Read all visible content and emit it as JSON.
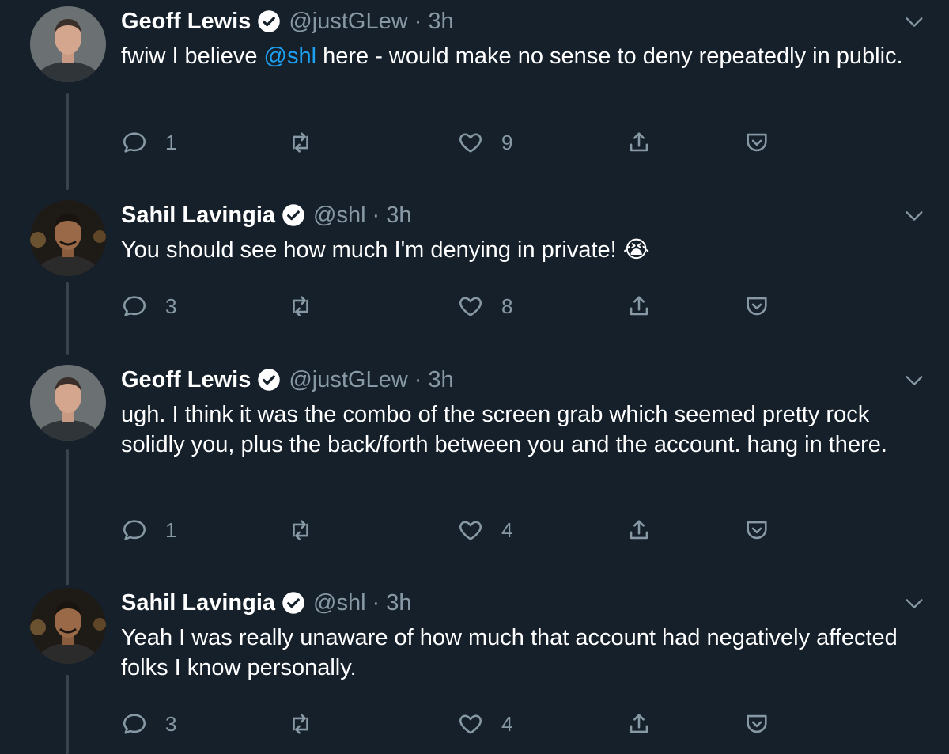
{
  "colors": {
    "background": "#15202b",
    "muted": "#8899a6",
    "link": "#1da1f2",
    "thread_line": "#38444d"
  },
  "tweets": [
    {
      "name": "Geoff Lewis",
      "handle": "@justGLew",
      "separator": "·",
      "time": "3h",
      "text_before": "fwiw I believe ",
      "mention": "@shl",
      "text_after": " here - would make no sense to deny repeatedly in public.",
      "replies": "1",
      "retweets": "",
      "likes": "9"
    },
    {
      "name": "Sahil Lavingia",
      "handle": "@shl",
      "separator": "·",
      "time": "3h",
      "text": "You should see how much I'm denying in private! 😭",
      "replies": "3",
      "retweets": "",
      "likes": "8"
    },
    {
      "name": "Geoff Lewis",
      "handle": "@justGLew",
      "separator": "·",
      "time": "3h",
      "text": "ugh. I think it was the combo of the screen grab which seemed pretty rock solidly you, plus the back/forth between you and the account. hang in there.",
      "replies": "1",
      "retweets": "",
      "likes": "4"
    },
    {
      "name": "Sahil Lavingia",
      "handle": "@shl",
      "separator": "·",
      "time": "3h",
      "text": "Yeah I was really unaware of how much that account had negatively affected folks I know personally.",
      "replies": "3",
      "retweets": "",
      "likes": "4"
    }
  ]
}
